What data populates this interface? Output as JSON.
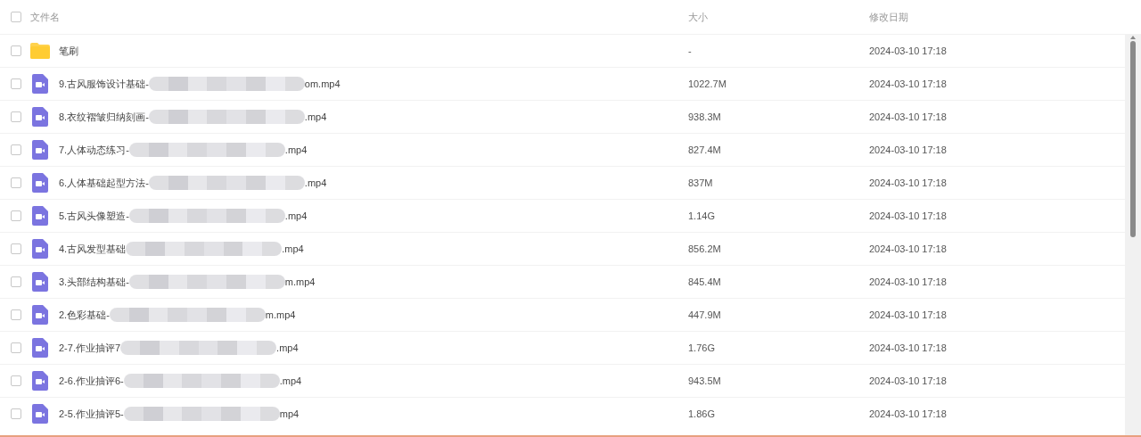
{
  "table": {
    "select_all": {
      "checked": false
    },
    "columns": [
      "文件名",
      "大小",
      "修改日期"
    ],
    "rows": [
      {
        "kind": "folder",
        "checked": false,
        "name": "笔刷",
        "size": "-",
        "modified": "2024-03-10 17:18"
      },
      {
        "kind": "video",
        "checked": false,
        "name": "9.古风服饰设计基础-",
        "name_end": "om.mp4",
        "size": "1022.7M",
        "modified": "2024-03-10 17:18"
      },
      {
        "kind": "video",
        "checked": false,
        "name": "8.衣纹褶皱归纳刻画-",
        "name_end": ".mp4",
        "size": "938.3M",
        "modified": "2024-03-10 17:18"
      },
      {
        "kind": "video",
        "checked": false,
        "name": "7.人体动态练习-",
        "name_end": ".mp4",
        "size": "827.4M",
        "modified": "2024-03-10 17:18"
      },
      {
        "kind": "video",
        "checked": false,
        "name": "6.人体基础起型方法-",
        "name_end": ".mp4",
        "size": "837M",
        "modified": "2024-03-10 17:18"
      },
      {
        "kind": "video",
        "checked": false,
        "name": "5.古风头像塑造-",
        "name_end": ".mp4",
        "size": "1.14G",
        "modified": "2024-03-10 17:18"
      },
      {
        "kind": "video",
        "checked": false,
        "name": "4.古风发型基础",
        "name_end": ".mp4",
        "size": "856.2M",
        "modified": "2024-03-10 17:18"
      },
      {
        "kind": "video",
        "checked": false,
        "name": "3.头部结构基础-",
        "name_end": "m.mp4",
        "size": "845.4M",
        "modified": "2024-03-10 17:18"
      },
      {
        "kind": "video",
        "checked": false,
        "name": "2.色彩基础-",
        "name_end": "m.mp4",
        "size": "447.9M",
        "modified": "2024-03-10 17:18"
      },
      {
        "kind": "video",
        "checked": false,
        "name": "2-7.作业抽评7",
        "name_end": ".mp4",
        "size": "1.76G",
        "modified": "2024-03-10 17:18"
      },
      {
        "kind": "video",
        "checked": false,
        "name": "2-6.作业抽评6-",
        "name_end": ".mp4",
        "size": "943.5M",
        "modified": "2024-03-10 17:18"
      },
      {
        "kind": "video",
        "checked": false,
        "name": "2-5.作业抽评5-",
        "name_end": "mp4",
        "size": "1.86G",
        "modified": "2024-03-10 17:18"
      }
    ]
  }
}
